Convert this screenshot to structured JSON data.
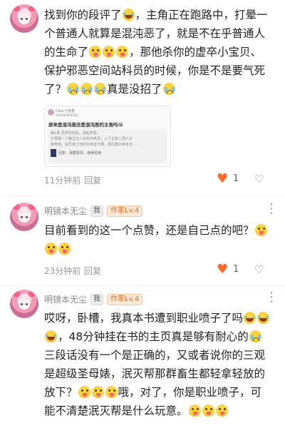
{
  "comment1": {
    "text": "找到你的段评了😂，主角正在跑路中，打晕一个普通人就算是混沌恶了，就是不在乎普通人的生命了🤪🤪🤪，那他杀你的虚卒小宝贝、保护邪恶空间站科员的时候，你是不是要气死了？😭😭😭真是没招了😭",
    "line1": "找到你的段评了",
    "line1b": "，主角正在跑路中，打晕一",
    "line2": "个普通人就算是混沌恶了，就是不在乎普通人",
    "line3": "的生命了",
    "line3b": "，那他杀你的虚卒小宝贝、",
    "line4": "保护邪恶空间站科员的时候，你是不是要气死",
    "line5": "了？",
    "line5b": "真是没招了",
    "card": {
      "header": "Dear小度量",
      "sub": "2024年09月08日",
      "title": "原来是混沌善还是混沌恶的主角吗😂",
      "body1": "第1章 异界空间站，混乱阵营。",
      "body2": "打晕路一个路过无人杀的外卖员，三下五除二把人打",
      "body3": "晕倒地，就早用了他的外卖送卡槽，便向着外卖走去……",
      "link": "回复：我要投票，继续阅读"
    },
    "time": "11分钟前",
    "reply": "回复",
    "likes": "1"
  },
  "comment2": {
    "username": "明镜本无尘",
    "badge_me": "我",
    "badge_author": "作家Lv.4",
    "text": "目前看到的这一个点赞，还是自己点的吧？🤪🤪🤪",
    "line1": "目前看到的这一个点赞，还是自己点的吧？",
    "time": "23分钟前",
    "reply": "回复",
    "likes": "1"
  },
  "comment3": {
    "username": "明镜本无尘",
    "badge_me": "我",
    "badge_author": "作家Lv.4",
    "text": "哎呀，卧槽，我真本书遭到职业喷子了吗😂😂😂，48分钟挂在书的主页真是够有耐心的😭，三段话没有一个是正确的，又或者说你的三观是超级圣母婊，泯灭帮那群畜生都轻拿轻放的放下？🤪🤪🤪哦，对了，你是职业喷子，可能不清楚泯灭帮是什么玩意。🤪🤪🤪",
    "line1": "哎呀，卧槽，我真本书遭到职业喷子了吗",
    "line2": "，48分钟挂在书的主页真是够有耐心的",
    "line3": "三段话没有一个是正确的，又或者说你的三观",
    "line4": "是超级圣母婊，泯灭帮那群畜生都轻拿轻放的",
    "line5": "放下？",
    "line5b": "哦，对了，你是职业喷子，可",
    "line6": "能不清楚泯灭帮是什么玩意。"
  },
  "icons": {
    "like": "heart-icon",
    "dislike": "broken-heart-icon",
    "more": "more-dots-icon",
    "emoji_laugh": "face-with-tears-of-joy",
    "emoji_tongue": "zany-face",
    "emoji_cry": "loudly-crying-face"
  },
  "colors": {
    "accent": "#ff6a2b",
    "author_badge": "#e26d1b",
    "muted": "#999999"
  }
}
